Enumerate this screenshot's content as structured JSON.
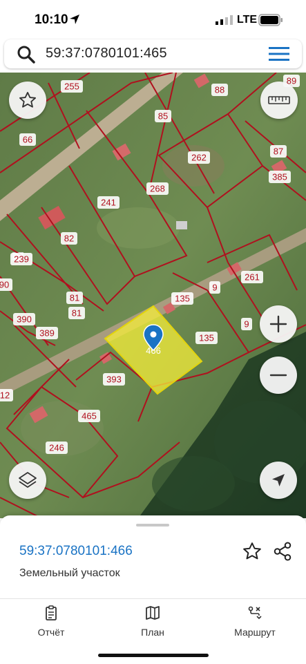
{
  "status": {
    "time": "10:10",
    "network": "LTE"
  },
  "search": {
    "value": "59:37:0780101:465"
  },
  "map": {
    "selected_label": "466",
    "parcel_labels": [
      "255",
      "88",
      "89",
      "66",
      "85",
      "262",
      "87",
      "385",
      "268",
      "241",
      "82",
      "239",
      "90",
      "81",
      "81",
      "390",
      "389",
      "261",
      "135",
      "9",
      "9",
      "135",
      "393",
      "12",
      "465",
      "246"
    ]
  },
  "sheet": {
    "parcel_id": "59:37:0780101:466",
    "parcel_type": "Земельный участок"
  },
  "tabs": [
    {
      "label": "Отчёт"
    },
    {
      "label": "План"
    },
    {
      "label": "Маршрут"
    }
  ],
  "colors": {
    "accent": "#1a73c4",
    "boundary": "#b0101e",
    "highlight": "#f6ee3a"
  }
}
